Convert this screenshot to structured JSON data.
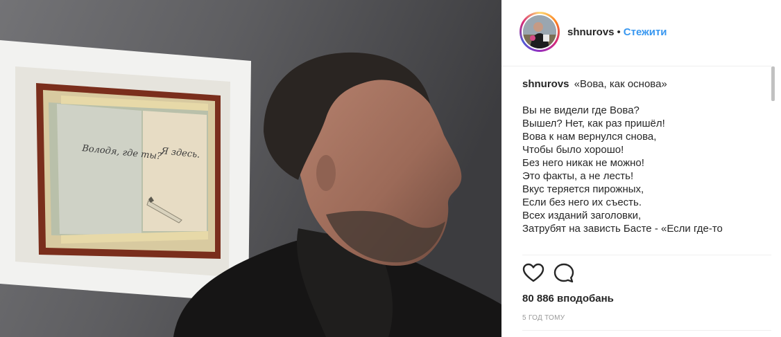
{
  "post": {
    "author": "shnurovs",
    "separator": "•",
    "follow_label": "Стежити",
    "caption_title": "«Вова, как основа»",
    "caption_lines": [
      "Вы не видели где Вова?",
      "Вышел? Нет, как раз пришёл!",
      "Вова к нам вернулся снова,",
      "Чтобы было хорошо!",
      "Без него никак не можно!",
      "Это факты, а не лесть!",
      "Вкус теряется пирожных,",
      "Если без него их съесть.",
      "Всех изданий заголовки,",
      "Затрубят на зависть Басте - «Если где-то"
    ],
    "likes": "80 886 вподобань",
    "time_ago": "5 ГОД ТОМУ"
  },
  "photo": {
    "artwork_left_text": "Володя, где ты?",
    "artwork_right_text": "Я здесь."
  },
  "icons": {
    "like": "heart-icon",
    "comment": "comment-icon"
  },
  "colors": {
    "follow": "#3897f0",
    "text": "#262626",
    "muted": "#999999",
    "divider": "#efefef"
  }
}
